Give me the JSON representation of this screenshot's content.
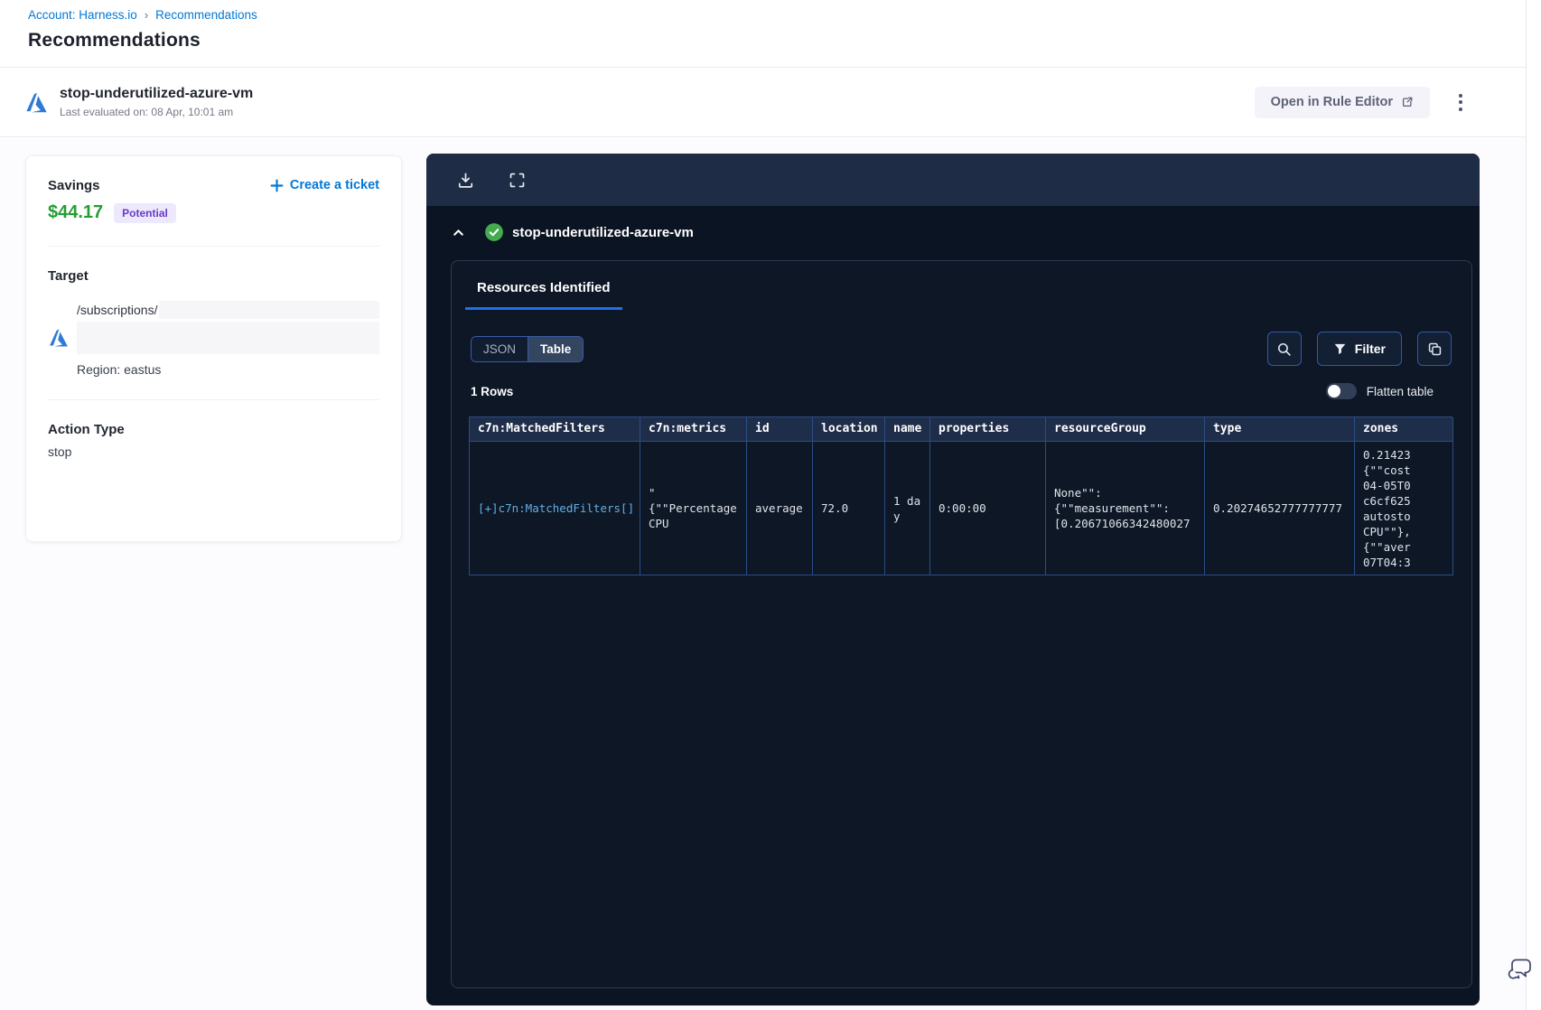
{
  "breadcrumb": {
    "account": "Account: Harness.io",
    "separator": "›",
    "current": "Recommendations"
  },
  "page_title": "Recommendations",
  "header": {
    "title": "stop-underutilized-azure-vm",
    "subtitle": "Last evaluated on: 08 Apr, 10:01 am",
    "open_rule_editor_label": "Open in Rule Editor"
  },
  "savings_card": {
    "savings_label": "Savings",
    "create_ticket_label": "Create a ticket",
    "amount": "$44.17",
    "badge": "Potential",
    "target_label": "Target",
    "target_path_prefix": "/subscriptions/",
    "region": "Region: eastus",
    "action_type_label": "Action Type",
    "action_type_value": "stop"
  },
  "panel": {
    "title": "stop-underutilized-azure-vm",
    "tab_label": "Resources Identified",
    "view_toggle": {
      "json_label": "JSON",
      "table_label": "Table",
      "active": "Table"
    },
    "filter_label": "Filter",
    "rows_count": "1 Rows",
    "flatten_label": "Flatten table",
    "flatten_enabled": false,
    "table": {
      "columns": [
        "c7n:MatchedFilters",
        "c7n:metrics",
        "id",
        "location",
        "name",
        "properties",
        "resourceGroup",
        "type",
        "zones"
      ],
      "row": {
        "matched_filters": "[+]c7n:MatchedFilters[]",
        "metrics": "\"\n{\"\"Percentage\nCPU",
        "id": "average",
        "location": "72.0",
        "name": "1 day",
        "properties": "0:00:00",
        "resource_group": "None\"\":\n{\"\"measurement\"\":\n[0.20671066342480027",
        "type": "0.20274652777777777",
        "zones": "0.21423\n{\"\"cost\n04-05T0\nc6cf625\nautosto\nCPU\"\"},\n{\"\"aver\n07T04:3"
      }
    }
  },
  "colors": {
    "accent_blue": "#0278d5",
    "savings_green": "#239e34",
    "badge_bg": "#ece9fc",
    "badge_text": "#6a39c9",
    "panel_toolbar": "#1e2c45",
    "panel_body": "#0b1422",
    "table_header_bg": "#1e2d49",
    "table_border": "#2b4d85",
    "tab_underline": "#2170e8",
    "success_green": "#45ab4f"
  }
}
